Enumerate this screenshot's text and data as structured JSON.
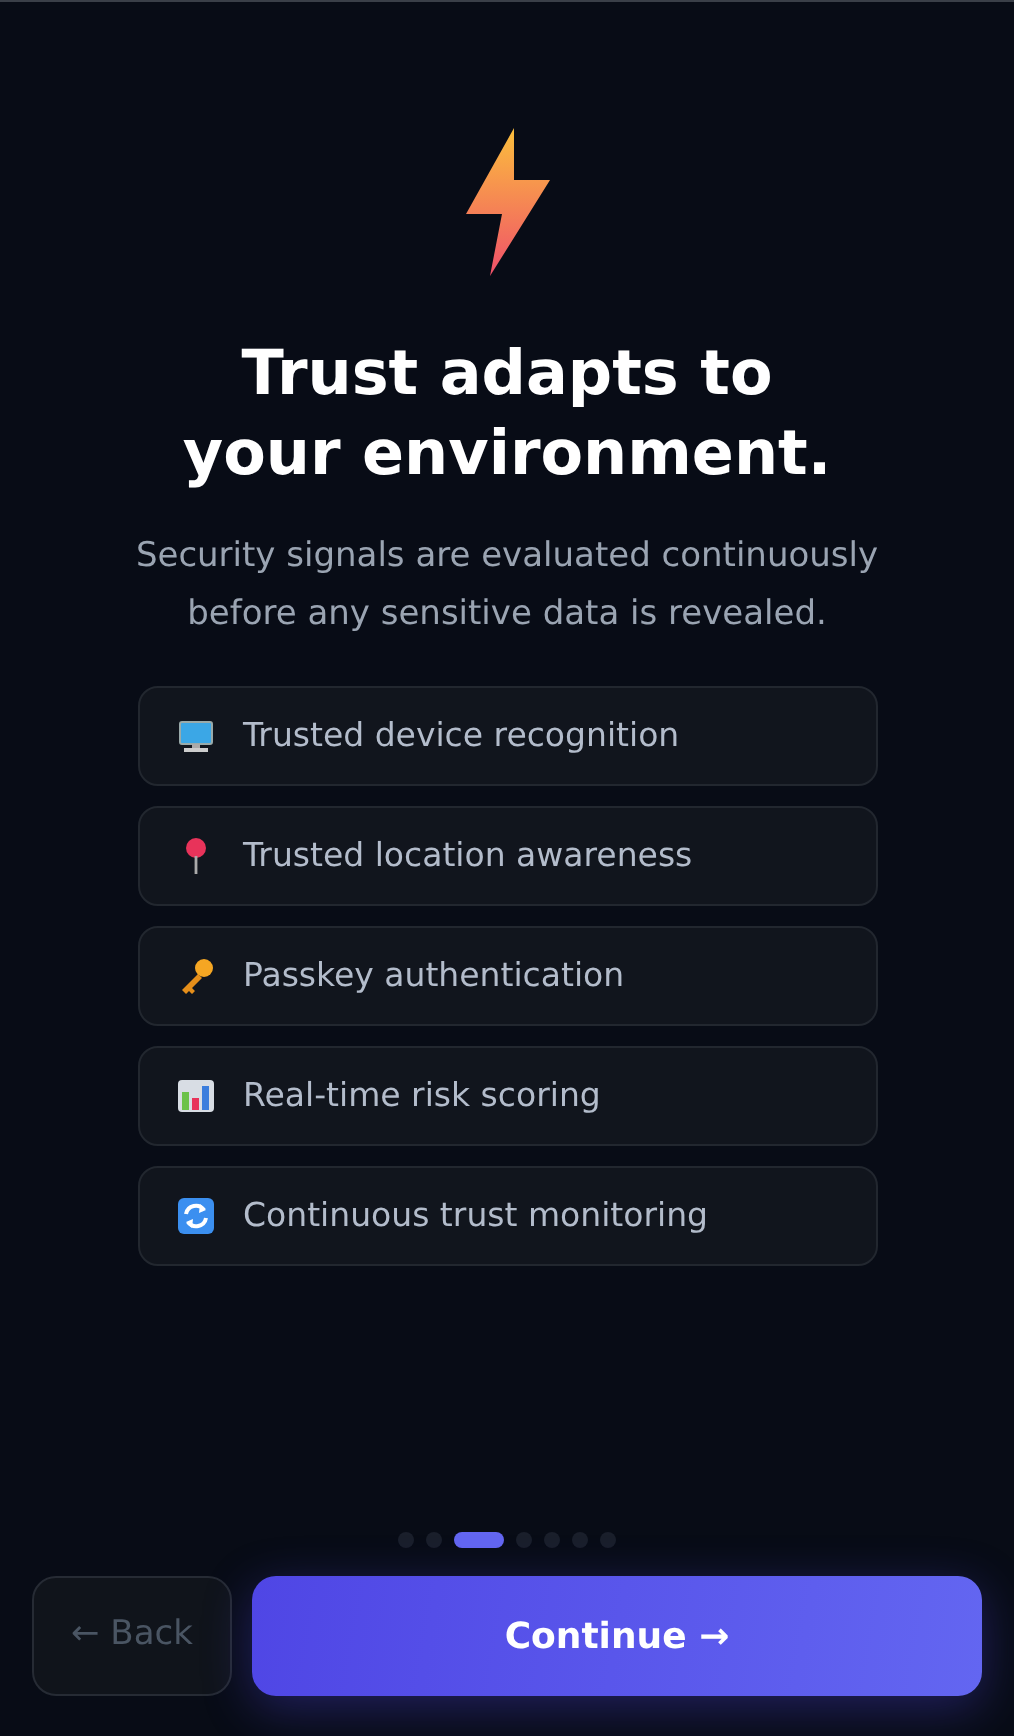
{
  "title": "Trust adapts to your environment.",
  "subtitle": "Security signals are evaluated continuously before any sensitive data is revealed.",
  "features": [
    {
      "label": "Trusted device recognition"
    },
    {
      "label": "Trusted location awareness"
    },
    {
      "label": "Passkey authentication"
    },
    {
      "label": "Real-time risk scoring"
    },
    {
      "label": "Continuous trust monitoring"
    }
  ],
  "steps": [
    {
      "selected": false
    },
    {
      "selected": false
    },
    {
      "selected": true
    },
    {
      "selected": false
    },
    {
      "selected": false
    },
    {
      "selected": false
    },
    {
      "selected": false
    }
  ],
  "back_button": {
    "label": "← Back",
    "disabled": true
  },
  "continue_button": {
    "label": "Continue →"
  }
}
